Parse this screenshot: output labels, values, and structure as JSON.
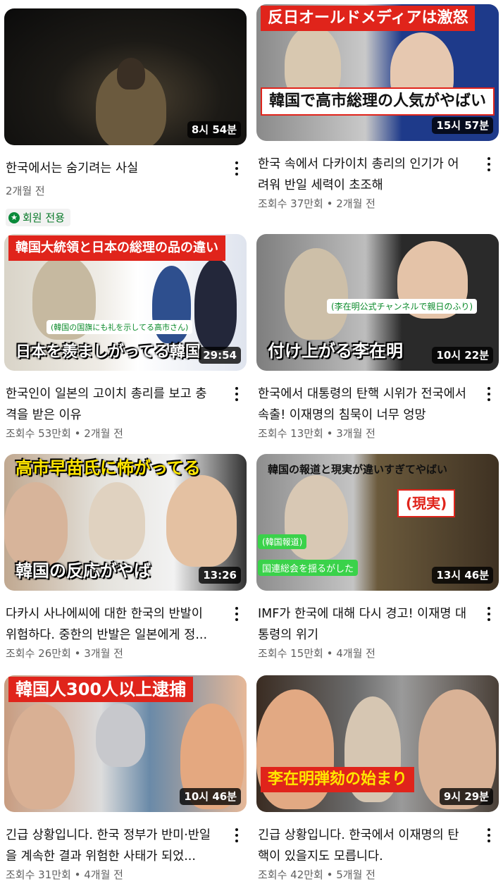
{
  "videos": [
    {
      "title": "한국에서는 숨기려는 사실",
      "duration": "8시 54분",
      "meta": "2개월 전",
      "badge": "회원 전용",
      "captions": []
    },
    {
      "title": "한국 속에서 다카이치 총리의 인기가 어려워 반일 세력이 초조해",
      "duration": "15시 57분",
      "meta": "조회수 37만회 • 2개월 전",
      "captions": [
        "反日オールドメディアは激怒",
        "韓国で高市総理の人気がやばい"
      ]
    },
    {
      "title": "한국인이 일본의 고이치 총리를 보고 충격을 받은 이유",
      "duration": "29:54",
      "meta": "조회수 53만회 • 2개월 전",
      "captions": [
        "韓国大統領と日本の総理の品の違い",
        "日本を羨ましがってる韓国",
        "(韓国の国旗にも礼を示してる高市さん)"
      ]
    },
    {
      "title": "한국에서 대통령의 탄핵 시위가 전국에서 속출! 이재명의 침묵이 너무 엉망",
      "duration": "10시 22분",
      "meta": "조회수 13만회 • 3개월 전",
      "captions": [
        "(李在明公式チャンネルで親日のふり)",
        "付け上がる李在明"
      ]
    },
    {
      "title": "다카시 사나에씨에 대한 한국의 반발이 위험하다. 중한의 반발은 일본에게 정...",
      "duration": "13:26",
      "meta": "조회수 26만회 • 3개월 전",
      "captions": [
        "高市早苗氏に怖がってる",
        "韓国の反応がやば"
      ]
    },
    {
      "title": "IMF가 한국에 대해 다시 경고! 이재명 대통령의 위기",
      "duration": "13시 46분",
      "meta": "조회수 15만회 • 4개월 전",
      "captions": [
        "韓国の報道と現実が違いすぎてやばい",
        "(現実)",
        "(韓国報道)",
        "国連総会を揺るがした"
      ]
    },
    {
      "title": "긴급 상황입니다. 한국 정부가 반미·반일을 계속한 결과 위험한 사태가 되었...",
      "duration": "10시 46분",
      "meta": "조회수 31만회 • 4개월 전",
      "captions": [
        "韓国人300人以上逮捕"
      ]
    },
    {
      "title": "긴급 상황입니다. 한국에서 이재명의 탄핵이 있을지도 모릅니다.",
      "duration": "9시 29분",
      "meta": "조회수 42만회 • 5개월 전",
      "captions": [
        "李在明弾劾の始まり"
      ]
    }
  ]
}
